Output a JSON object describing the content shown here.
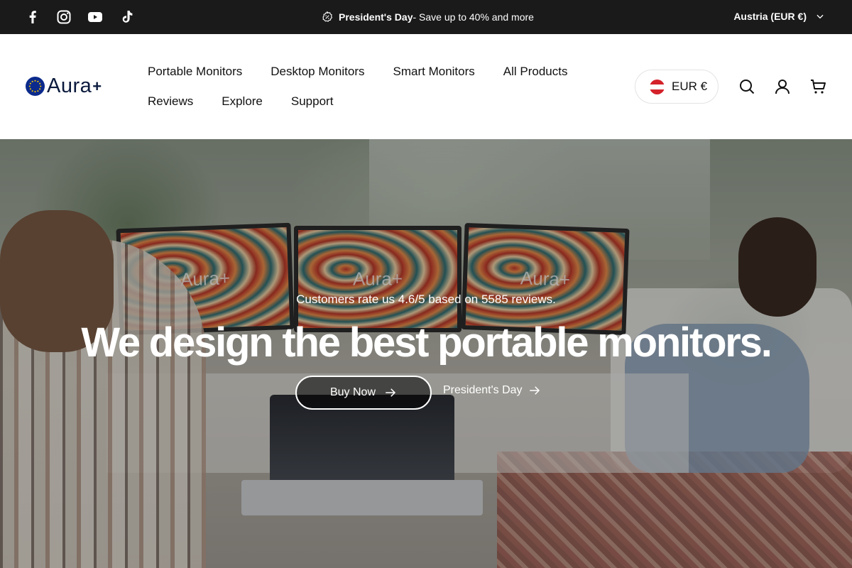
{
  "announcement": {
    "social_icons": [
      "facebook-icon",
      "instagram-icon",
      "youtube-icon",
      "tiktok-icon"
    ],
    "promo_bold": "President's Day",
    "promo_text": " - Save up to 40% and more",
    "region_label": "Austria (EUR €)"
  },
  "header": {
    "logo_text": "Aura",
    "logo_plus": "+",
    "nav": {
      "row1": [
        "Portable Monitors",
        "Desktop Monitors",
        "Smart Monitors",
        "All Products"
      ],
      "row2": [
        "Reviews",
        "Explore",
        "Support"
      ]
    },
    "currency_label": "EUR €"
  },
  "hero": {
    "monitor_brand": "Aura+",
    "rating_text": "Customers rate us 4.6/5 based on 5585 reviews.",
    "headline": "We design the best portable monitors.",
    "buy_label": "Buy Now",
    "promo_link_label": "President's Day"
  },
  "colors": {
    "announcement_bg": "#1a1a1a",
    "logo_blue": "#0b2a8c",
    "flag_red": "#d4222b",
    "text_dark": "#111111"
  }
}
